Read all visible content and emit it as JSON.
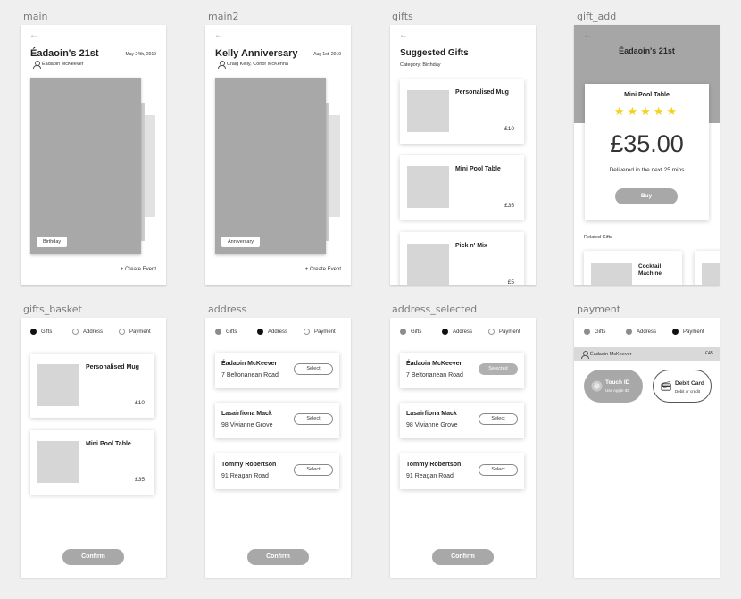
{
  "artboards": {
    "main": "main",
    "main2": "main2",
    "gifts": "gifts",
    "gift_add": "gift_add",
    "gifts_basket": "gifts_basket",
    "address": "address",
    "address_selected": "address_selected",
    "payment": "payment"
  },
  "icons": {
    "back": "back-arrow-icon",
    "person": "person-icon",
    "star": "star-icon",
    "fingerprint": "fingerprint-icon",
    "card": "credit-card-icon"
  },
  "colors": {
    "background": "#efefef",
    "placeholder": "#a8a8a8",
    "star": "#f2d21e",
    "active_step": "#111111",
    "done_step": "#8c8c8c"
  },
  "back_arrow": "←",
  "main": {
    "title": "Éadaoin's 21st",
    "date": "May 24th, 2019",
    "people": "Éadaoin McKeever",
    "tag": "Birthday",
    "create": "+ Create Event"
  },
  "main2": {
    "title": "Kelly Anniversary",
    "date": "Aug 1st, 2019",
    "people": "Craig Kelly, Conor McKenna",
    "tag": "Anniversary",
    "create": "+ Create Event"
  },
  "gifts": {
    "title": "Suggested Gifts",
    "category": "Category: Birthday",
    "items": [
      {
        "name": "Personalised Mug",
        "price": "£10"
      },
      {
        "name": "Mini Pool Table",
        "price": "£35"
      },
      {
        "name": "Pick n' Mix",
        "price": "£5"
      }
    ]
  },
  "gift_add": {
    "title": "Éadaoin's 21st",
    "product": "Mini Pool Table",
    "stars": "★★★★★",
    "rating": 5,
    "price": "£35.00",
    "delivery": "Delivered in the next 25 mins",
    "buy": "Buy",
    "related_label": "Related Gifts",
    "related": [
      {
        "name": "Cocktail Machine"
      }
    ]
  },
  "steps": {
    "gifts": "Gifts",
    "address": "Address",
    "payment": "Payment"
  },
  "gifts_basket": {
    "items": [
      {
        "name": "Personalised Mug",
        "price": "£10"
      },
      {
        "name": "Mini Pool Table",
        "price": "£35"
      }
    ],
    "confirm": "Confirm"
  },
  "address": {
    "entries": [
      {
        "name": "Éadaoin McKeever",
        "street": "7 Beltonanean Road",
        "button": "Select"
      },
      {
        "name": "Lasairfiona Mack",
        "street": "98 Vivianne Grove",
        "button": "Select"
      },
      {
        "name": "Tommy Robertson",
        "street": "91 Reagan Road",
        "button": "Select"
      }
    ],
    "confirm": "Confirm"
  },
  "address_selected": {
    "entries": [
      {
        "name": "Éadaoin McKeever",
        "street": "7 Beltonanean Road",
        "button": "Selected"
      },
      {
        "name": "Lasairfiona Mack",
        "street": "98 Vivianne Grove",
        "button": "Select"
      },
      {
        "name": "Tommy Robertson",
        "street": "91 Reagan Road",
        "button": "Select"
      }
    ],
    "confirm": "Confirm"
  },
  "payment": {
    "user": "Éadaoin McKeever",
    "amount": "£45",
    "touch_title": "Touch ID",
    "touch_sub": "Use Apple ID",
    "card_title": "Debit Card",
    "card_sub": "Debit or credit"
  }
}
